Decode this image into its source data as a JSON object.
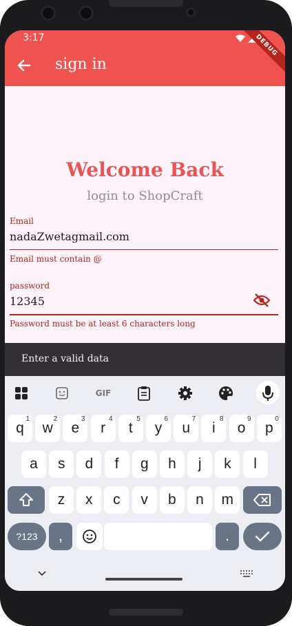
{
  "status": {
    "time": "3:17"
  },
  "appbar": {
    "title": "sign in",
    "debug_banner": "DEBUG"
  },
  "hero": {
    "title": "Welcome Back",
    "subtitle": "login to ShopCraft"
  },
  "form": {
    "email": {
      "label": "Email",
      "value": "nadaZwetagmail.com",
      "error": "Email must contain @"
    },
    "password": {
      "label": "password",
      "value": "12345",
      "error": "Password must be at least 6 characters long"
    }
  },
  "snackbar": {
    "message": "Enter a valid data"
  },
  "keyboard": {
    "toolbar": [
      "apps-icon",
      "sticker-icon",
      "GIF",
      "clipboard-icon",
      "settings-icon",
      "palette-icon",
      "mic-icon"
    ],
    "row1": [
      {
        "k": "q",
        "s": "1"
      },
      {
        "k": "w",
        "s": "2"
      },
      {
        "k": "e",
        "s": "3"
      },
      {
        "k": "r",
        "s": "4"
      },
      {
        "k": "t",
        "s": "5"
      },
      {
        "k": "y",
        "s": "6"
      },
      {
        "k": "u",
        "s": "7"
      },
      {
        "k": "i",
        "s": "8"
      },
      {
        "k": "o",
        "s": "9"
      },
      {
        "k": "p",
        "s": "0"
      }
    ],
    "row2": [
      "a",
      "s",
      "d",
      "f",
      "g",
      "h",
      "j",
      "k",
      "l"
    ],
    "row3": [
      "z",
      "x",
      "c",
      "v",
      "b",
      "n",
      "m"
    ],
    "row4": {
      "symbols": "?123",
      "comma": ",",
      "period": "."
    }
  },
  "colors": {
    "primary": "#ef5350",
    "error": "#b3261e",
    "background": "#fdf3fb",
    "snackbar": "#323034"
  }
}
